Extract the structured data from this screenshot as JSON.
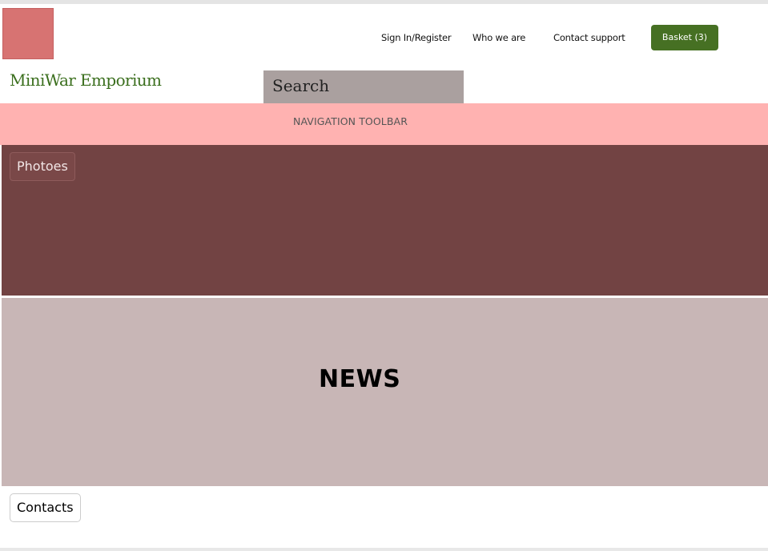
{
  "header": {
    "links": {
      "sign_in": "Sign In/Register",
      "who_we_are": "Who we are",
      "contact_support": "Contact support"
    },
    "basket_label": "Basket (3)",
    "brand_name": "MiniWar Emporium",
    "search_placeholder": "Search",
    "logo_icon": "logo-image-placeholder"
  },
  "navigation": {
    "label": "NAVIGATION TOOLBAR"
  },
  "photos": {
    "button_label": "Photoes"
  },
  "news": {
    "title": "NEWS"
  },
  "footer": {
    "contacts_label": "Contacts"
  },
  "colors": {
    "brand_green": "#467023",
    "nav_pink": "#ffb2b1",
    "photos_bg": "#724343",
    "news_bg": "#c8b6b6",
    "search_bg": "#aaa09f"
  }
}
